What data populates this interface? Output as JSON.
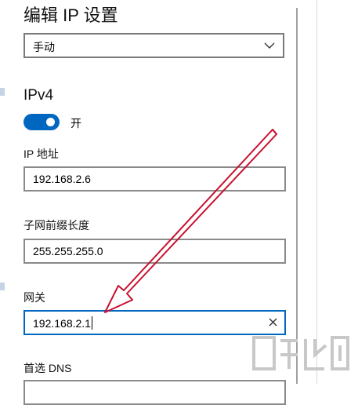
{
  "dialog": {
    "title": "编辑 IP 设置",
    "mode_dropdown": {
      "selected": "手动",
      "icon": "chevron-down-icon"
    }
  },
  "ipv4": {
    "heading": "IPv4",
    "toggle": {
      "state_label": "开",
      "on": true
    },
    "fields": [
      {
        "label": "IP 地址",
        "value": "192.168.2.6"
      },
      {
        "label": "子网前缀长度",
        "value": "255.255.255.0"
      },
      {
        "label": "网关",
        "value": "192.168.2.1"
      },
      {
        "label": "首选 DNS",
        "value": ""
      }
    ]
  },
  "colors": {
    "accent": "#0067c0",
    "annotation_arrow": "#c8102e"
  }
}
